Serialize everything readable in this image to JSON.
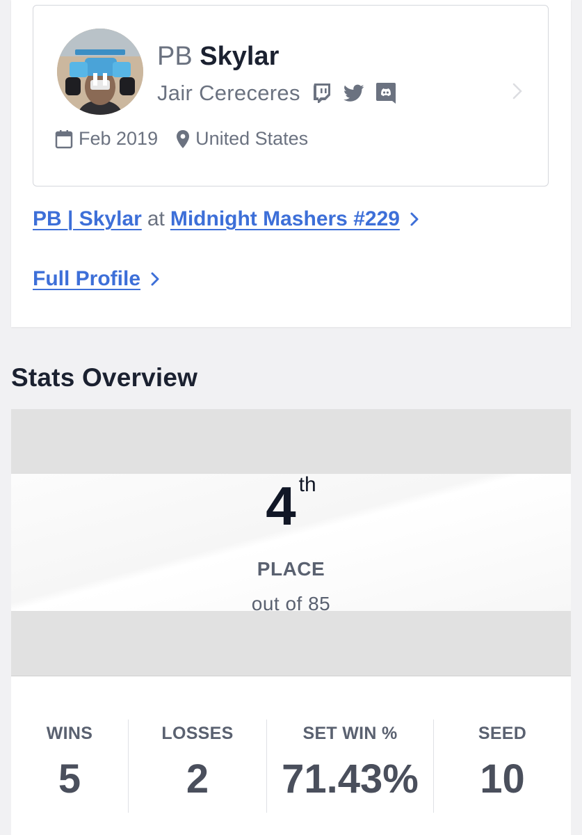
{
  "profile": {
    "prefix": "PB",
    "gamertag": "Skylar",
    "real_name": "Jair Cereceres",
    "social_icons": [
      "twitch-icon",
      "twitter-icon",
      "discord-icon"
    ],
    "joined": "Feb 2019",
    "location": "United States"
  },
  "links": {
    "entrant": "PB | Skylar",
    "at": "at",
    "event": "Midnight Mashers #229",
    "full_profile": "Full Profile"
  },
  "stats": {
    "title": "Stats Overview",
    "place": "4",
    "place_suffix": "th",
    "place_label": "PLACE",
    "out_of": "out of 85",
    "items": [
      {
        "label": "WINS",
        "value": "5"
      },
      {
        "label": "LOSSES",
        "value": "2"
      },
      {
        "label": "SET WIN %",
        "value": "71.43%"
      },
      {
        "label": "SEED",
        "value": "10"
      }
    ]
  },
  "colors": {
    "link": "#3d6fd8",
    "muted": "#6b7280",
    "text": "#1b2130"
  }
}
